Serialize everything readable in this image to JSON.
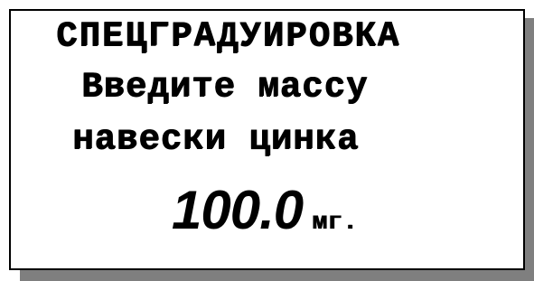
{
  "display": {
    "title": "СПЕЦГРАДУИРОВКА",
    "prompt_line1": "Введите массу",
    "prompt_line2": "навески цинка",
    "value": "100.0",
    "unit": "мг."
  }
}
